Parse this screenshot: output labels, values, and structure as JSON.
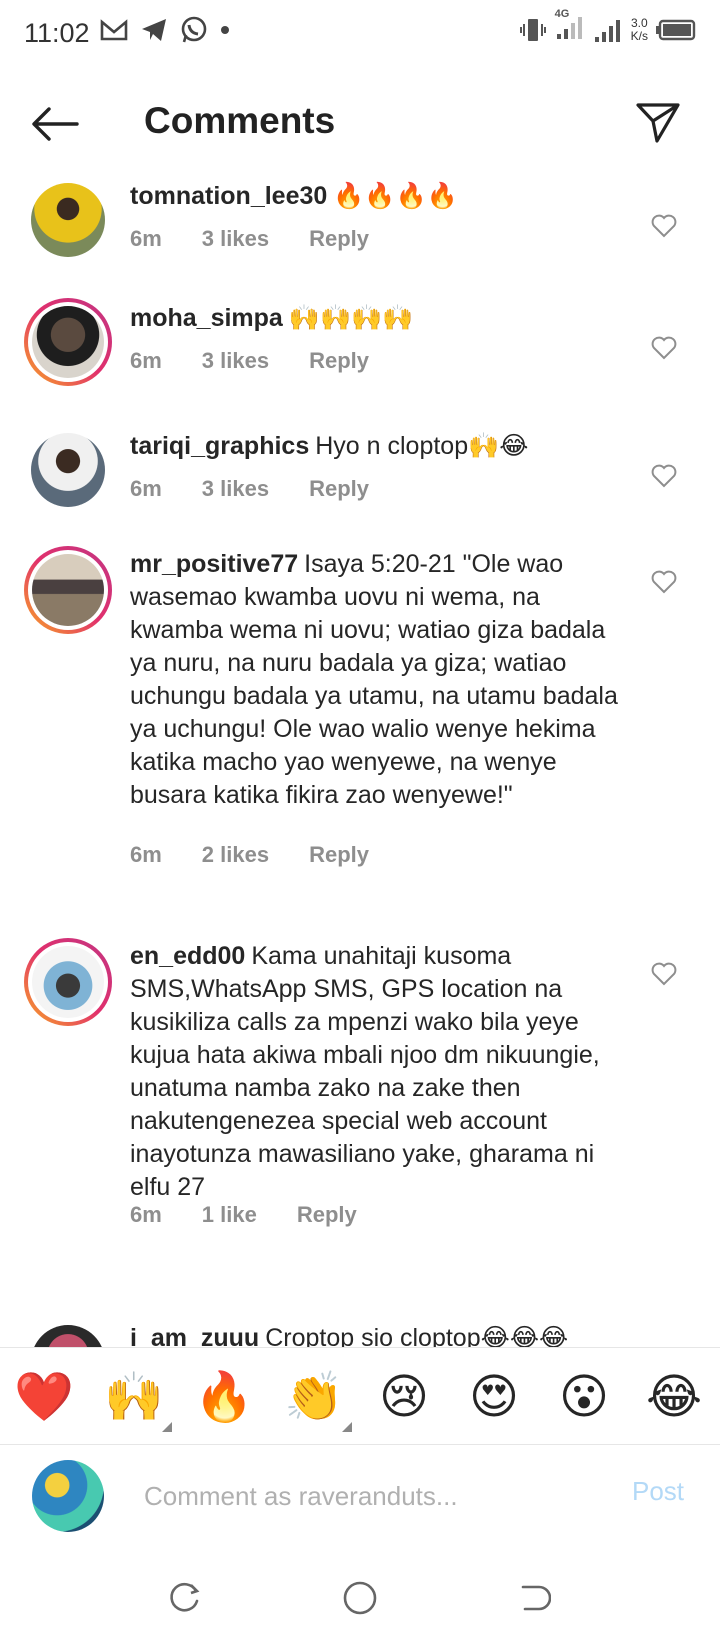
{
  "status_bar": {
    "time": "11:02",
    "network": "4G",
    "speed_value": "3.0",
    "speed_unit": "K/s",
    "icons": [
      "gmail-icon",
      "telegram-icon",
      "whatsapp-icon",
      "dot-icon",
      "vibrate-icon",
      "signal-icon",
      "signal-icon",
      "battery-icon"
    ]
  },
  "header": {
    "title": "Comments",
    "back_icon": "arrow-left-icon",
    "share_icon": "paper-plane-icon"
  },
  "comments": [
    {
      "username": "tomnation_lee30",
      "text": "🔥🔥🔥🔥",
      "time": "6m",
      "likes": "3 likes",
      "reply": "Reply",
      "story_ring": false,
      "avatar_color": "#e8c21a"
    },
    {
      "username": "moha_simpa",
      "text": "🙌🙌🙌🙌",
      "time": "6m",
      "likes": "3 likes",
      "reply": "Reply",
      "story_ring": true,
      "avatar_color": "#5a4a3f"
    },
    {
      "username": "tariqi_graphics",
      "text": "Hyo n cloptop🙌😂",
      "time": "6m",
      "likes": "3 likes",
      "reply": "Reply",
      "story_ring": false,
      "avatar_color": "#4a5a6a"
    },
    {
      "username": "mr_positive77",
      "text": "Isaya 5:20-21 \"Ole wao wasemao kwamba uovu ni wema, na kwamba wema ni uovu; watiao giza badala ya nuru, na nuru badala ya giza; watiao uchungu badala ya utamu, na utamu badala ya uchungu! Ole wao walio wenye hekima katika macho yao wenyewe, na wenye busara katika fikira zao wenyewe!\"",
      "time": "6m",
      "likes": "2 likes",
      "reply": "Reply",
      "story_ring": true,
      "avatar_color": "#8a7a66"
    },
    {
      "username": "en_edd00",
      "text": "Kama unahitaji kusoma SMS,WhatsApp SMS, GPS location na kusikiliza calls za mpenzi wako bila yeye kujua hata akiwa mbali njoo dm nikuungie, unatuma namba zako na zake then nakutengenezea special web account inayotunza mawasiliano yake, gharama ni elfu 27",
      "time": "6m",
      "likes": "1 like",
      "reply": "Reply",
      "story_ring": true,
      "avatar_color": "#7fb3d5"
    },
    {
      "username": "i_am_zuuu",
      "text": "Croptop sio cloptop😂😂😂",
      "time": "",
      "likes": "",
      "reply": "",
      "story_ring": false,
      "avatar_color": "#c0506a"
    }
  ],
  "emoji_bar": [
    "❤️",
    "🙌",
    "🔥",
    "👏",
    "😢",
    "😍",
    "😮",
    "😂"
  ],
  "composer": {
    "placeholder": "Comment as raveranduts...",
    "post_label": "Post"
  },
  "colors": {
    "text": "#262626",
    "meta": "#8e8e8e",
    "post_disabled": "#b3d9f7",
    "story_ring_start": "#f9a825",
    "story_ring_end": "#c13584"
  }
}
